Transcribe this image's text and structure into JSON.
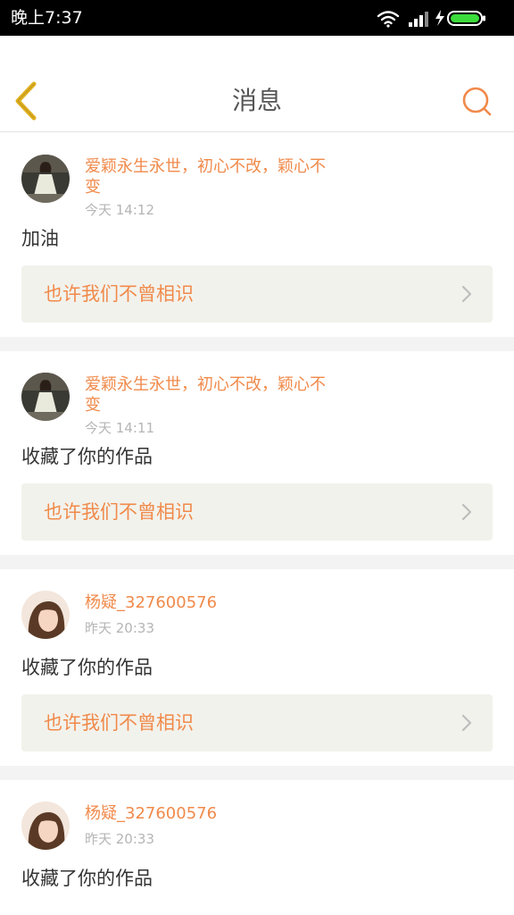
{
  "status_bar": {
    "time": "晚上7:37",
    "icons": [
      "wifi-icon",
      "signal-icon",
      "charging-icon",
      "battery-icon"
    ]
  },
  "header": {
    "title": "消息",
    "back_icon": "chevron-left-icon",
    "search_icon": "search-icon"
  },
  "colors": {
    "accent": "#f08a4b",
    "back_icon": "#e0b020",
    "card_link_bg": "#f2f2ec",
    "divider": "#f3f3f3"
  },
  "messages": [
    {
      "user": "爱颖永生永世，初心不改，颖心不变",
      "time": "今天 14:12",
      "text": "加油",
      "work_title": "也许我们不曾相识"
    },
    {
      "user": "爱颖永生永世，初心不改，颖心不变",
      "time": "今天 14:11",
      "text": "收藏了你的作品",
      "work_title": "也许我们不曾相识"
    },
    {
      "user": "杨疑_327600576",
      "time": "昨天 20:33",
      "text": "收藏了你的作品",
      "work_title": "也许我们不曾相识"
    },
    {
      "user": "杨疑_327600576",
      "time": "昨天 20:33",
      "text": "收藏了你的作品",
      "work_title": ""
    }
  ]
}
